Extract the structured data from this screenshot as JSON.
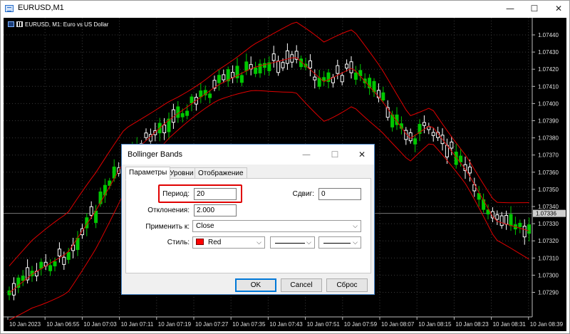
{
  "window": {
    "title": "EURUSD,M1",
    "minimize": "—",
    "maximize": "☐",
    "close": "✕"
  },
  "chart": {
    "header": "EURUSD, M1:  Euro vs US Dollar",
    "current_price": "1.07336",
    "price_labels": [
      "1.07440",
      "1.07430",
      "1.07420",
      "1.07410",
      "1.07400",
      "1.07390",
      "1.07380",
      "1.07370",
      "1.07360",
      "1.07350",
      "1.07340",
      "1.07330",
      "1.07320",
      "1.07310",
      "1.07300",
      "1.07290"
    ],
    "time_labels": [
      "10 Jan 2023",
      "10 Jan 06:55",
      "10 Jan 07:03",
      "10 Jan 07:11",
      "10 Jan 07:19",
      "10 Jan 07:27",
      "10 Jan 07:35",
      "10 Jan 07:43",
      "10 Jan 07:51",
      "10 Jan 07:59",
      "10 Jan 08:07",
      "10 Jan 08:15",
      "10 Jan 08:23",
      "10 Jan 08:31",
      "10 Jan 08:39"
    ],
    "colors": {
      "bull": "#00c800",
      "bear": "#ffffff",
      "band": "#e00000",
      "grid": "#3a3a3a"
    }
  },
  "dialog": {
    "title": "Bollinger Bands",
    "tabs": [
      "Параметры",
      "Уровни",
      "Отображение"
    ],
    "period_label": "Период:",
    "period_value": "20",
    "shift_label": "Сдвиг:",
    "shift_value": "0",
    "deviation_label": "Отклонения:",
    "deviation_value": "2.000",
    "apply_label": "Применить к:",
    "apply_value": "Close",
    "style_label": "Стиль:",
    "color_value": "Red",
    "buttons": {
      "ok": "OK",
      "cancel": "Cancel",
      "reset": "Сброс"
    }
  }
}
